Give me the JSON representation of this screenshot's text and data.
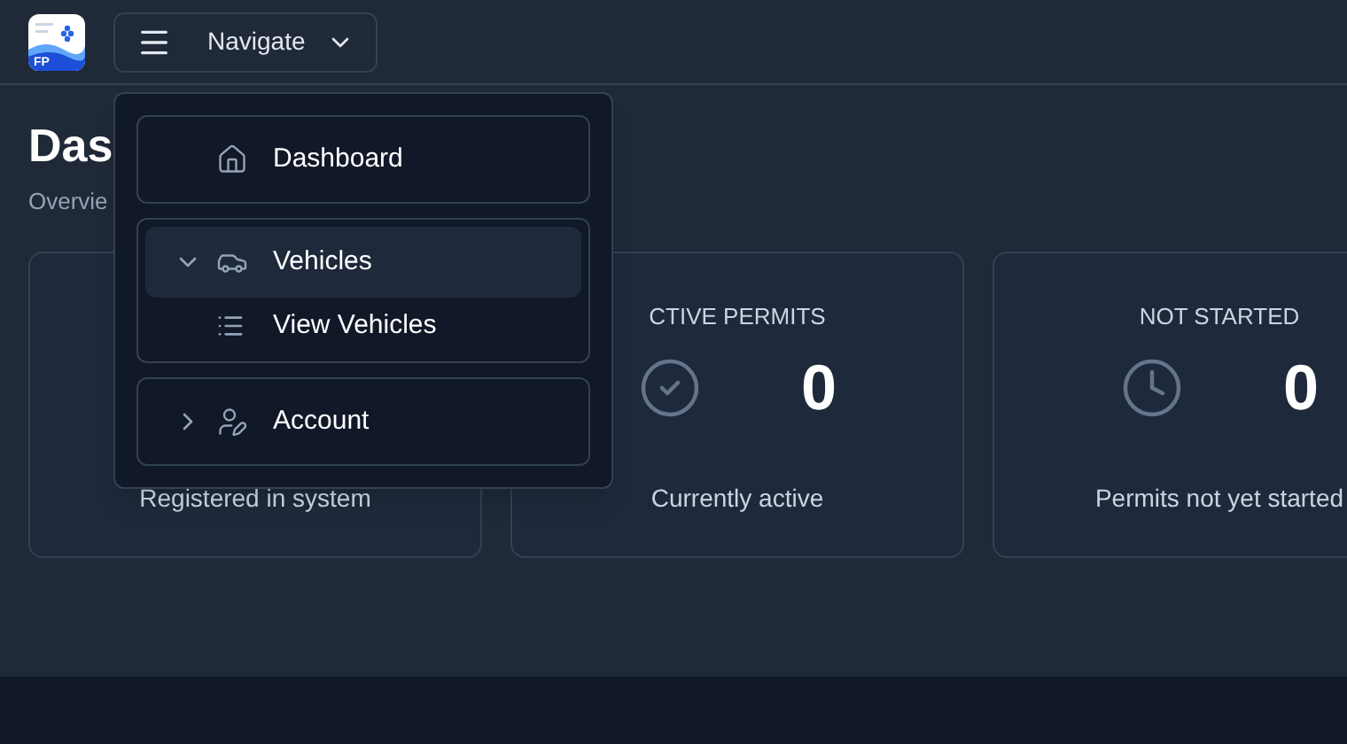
{
  "header": {
    "logo_text": "FP",
    "nav_button": "Navigate"
  },
  "page": {
    "title": "Das",
    "subtitle": "Overvie"
  },
  "cards": [
    {
      "caption": "Registered in system"
    },
    {
      "label": "CTIVE PERMITS",
      "value": "0",
      "caption": "Currently active"
    },
    {
      "label": "NOT STARTED",
      "value": "0",
      "caption": "Permits not yet started"
    }
  ],
  "menu": {
    "items": [
      {
        "label": "Dashboard",
        "kind": "link",
        "selected": false
      },
      {
        "label": "Vehicles",
        "kind": "group",
        "expanded": true,
        "selected": true,
        "children": [
          {
            "label": "View Vehicles"
          }
        ]
      },
      {
        "label": "Account",
        "kind": "group",
        "expanded": false,
        "selected": false
      }
    ]
  }
}
